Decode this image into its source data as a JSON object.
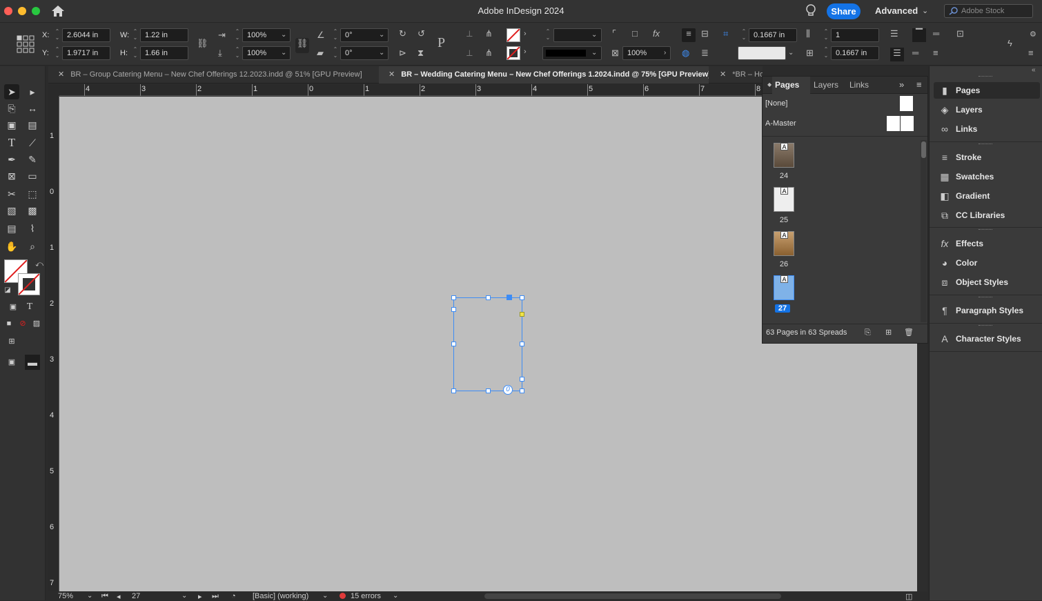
{
  "window": {
    "title": "Adobe InDesign 2024",
    "share_label": "Share",
    "workspace_label": "Advanced",
    "stock_placeholder": "Adobe Stock"
  },
  "control": {
    "x_label": "X:",
    "x_value": "2.6044 in",
    "y_label": "Y:",
    "y_value": "1.9717 in",
    "w_label": "W:",
    "w_value": "1.22 in",
    "h_label": "H:",
    "h_value": "1.66 in",
    "scale_x": "100%",
    "scale_y": "100%",
    "rotate": "0°",
    "shear": "0°",
    "opacity": "100%",
    "inset1": "0.1667 in",
    "inset2": "0.1667 in",
    "columns": "1"
  },
  "tabs": [
    {
      "label": "BR – Group Catering Menu – New Chef Offerings 12.2023.indd @ 51% [GPU Preview]"
    },
    {
      "label": "BR – Wedding Catering Menu – New Chef Offerings 1.2024.indd @ 75% [GPU Preview]"
    },
    {
      "label": "*BR – Ho"
    }
  ],
  "ruler": {
    "h": [
      "4",
      "3",
      "2",
      "1",
      "0",
      "1",
      "2",
      "3",
      "4",
      "5",
      "6",
      "7",
      "8"
    ],
    "v": [
      "1",
      "0",
      "1",
      "2",
      "3",
      "4",
      "5",
      "6",
      "7"
    ]
  },
  "pages_panel": {
    "tabs": [
      "Pages",
      "Layers",
      "Links"
    ],
    "masters": [
      "[None]",
      "A-Master"
    ],
    "pages": [
      {
        "num": "24",
        "master": "A"
      },
      {
        "num": "25",
        "master": "A"
      },
      {
        "num": "26",
        "master": "A"
      },
      {
        "num": "27",
        "master": "A"
      }
    ],
    "footer": "63 Pages in 63 Spreads"
  },
  "right_panel": [
    {
      "label": "Pages",
      "icon": "pages-icon"
    },
    {
      "label": "Layers",
      "icon": "layers-icon"
    },
    {
      "label": "Links",
      "icon": "links-icon"
    },
    {
      "label": "Stroke",
      "icon": "stroke-icon"
    },
    {
      "label": "Swatches",
      "icon": "swatches-icon"
    },
    {
      "label": "Gradient",
      "icon": "gradient-icon"
    },
    {
      "label": "CC Libraries",
      "icon": "cc-libraries-icon"
    },
    {
      "label": "Effects",
      "icon": "effects-icon"
    },
    {
      "label": "Color",
      "icon": "color-icon"
    },
    {
      "label": "Object Styles",
      "icon": "object-styles-icon"
    },
    {
      "label": "Paragraph Styles",
      "icon": "paragraph-styles-icon"
    },
    {
      "label": "Character Styles",
      "icon": "character-styles-icon"
    }
  ],
  "status": {
    "zoom": "75%",
    "page": "27",
    "preflight_profile": "[Basic] (working)",
    "errors": "15 errors"
  },
  "colors": {
    "accent": "#1473e6",
    "selection": "#3d8cf5",
    "canvas": "#bebebe",
    "error": "#e03a3a"
  }
}
